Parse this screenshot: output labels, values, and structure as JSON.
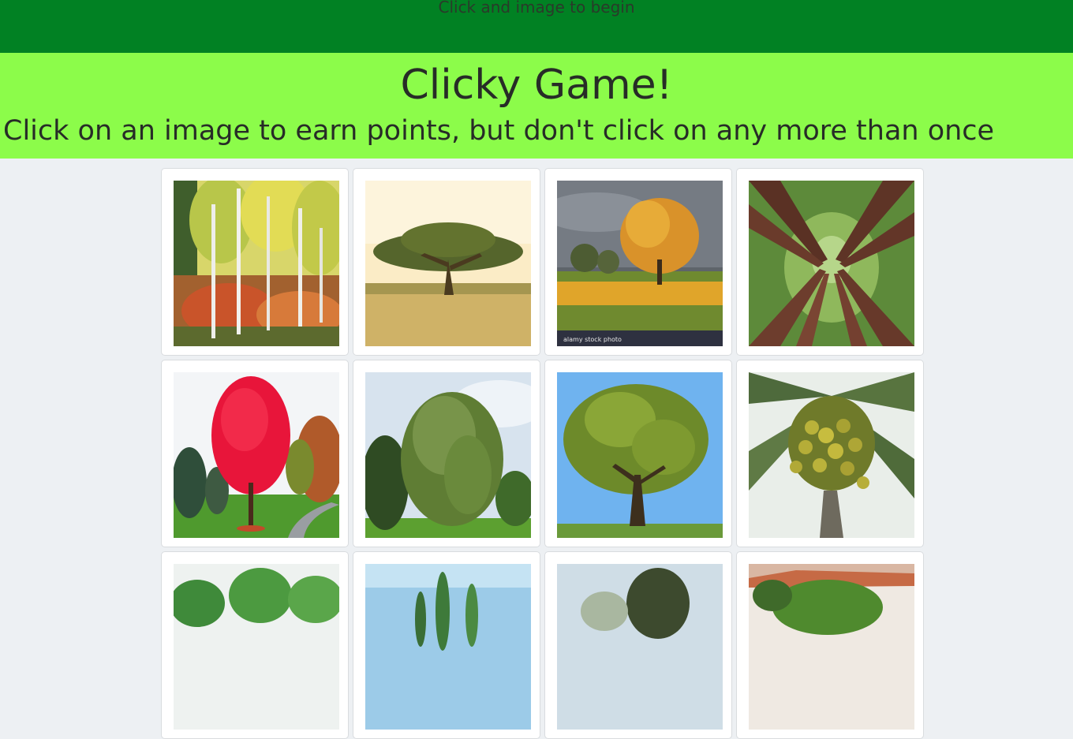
{
  "navbar": {
    "message": "Click and image to begin"
  },
  "header": {
    "title": "Clicky Game!",
    "subtitle": "Click on an image to earn points, but don't click on any more than once"
  },
  "images": [
    {
      "id": "birch-forest",
      "watermark": ""
    },
    {
      "id": "acacia-savanna",
      "watermark": ""
    },
    {
      "id": "orange-autumn-tree",
      "watermark": "alamy stock photo"
    },
    {
      "id": "redwood-canopy",
      "watermark": ""
    },
    {
      "id": "red-maple",
      "watermark": ""
    },
    {
      "id": "weeping-willow",
      "watermark": ""
    },
    {
      "id": "oak-tree",
      "watermark": ""
    },
    {
      "id": "coconut-palm",
      "watermark": ""
    },
    {
      "id": "banana-plants",
      "watermark": ""
    },
    {
      "id": "cypress-trees",
      "watermark": ""
    },
    {
      "id": "dark-tree",
      "watermark": ""
    },
    {
      "id": "potted-palm",
      "watermark": ""
    }
  ],
  "colors": {
    "navbar": "#018123",
    "jumbotron": "#8cfc4a",
    "background": "#edf0f3"
  }
}
